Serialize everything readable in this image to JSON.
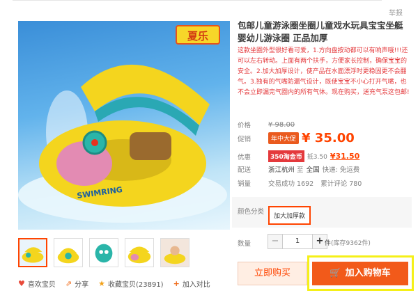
{
  "report_label": "举报",
  "brand_logo": "夏乐",
  "product": {
    "title": "包邮儿童游泳圈坐圈儿童戏水玩具宝宝坐艇婴幼儿游泳圈 正品加厚",
    "description": "这款坐圈外型很好看可爱，1.方向盘按动都可以有响声哦!!!还可以左右转动。上面有两个扶手，方便家长控制，确保宝宝的安全。2.加大加厚设计，使产品在水面漂浮时更稳固更不会翻气。3.独有的气嘴防漏气设计，既使宝宝不小心打开气嘴，也不会立即漏完气圈内的所有气体。现在购买，送充气泵这包邮!"
  },
  "price": {
    "price_label": "价格",
    "original": "¥ 98.00",
    "promo_label": "促销",
    "promo_tag": "年中大促",
    "promo_price": "¥ 35.00",
    "discount_label": "优惠",
    "coupon": "350淘金币",
    "coupon_text": "抵3.50",
    "discount_price": "¥31.50",
    "ship_label": "配送",
    "ship_from": "浙江杭州",
    "ship_to_word": "至",
    "ship_to": "全国",
    "ship_fee": "快递: 免运费",
    "sales_label": "销量",
    "sales": "交易成功 1692",
    "reviews": "累计评论 780"
  },
  "options": {
    "color_label": "颜色分类",
    "color_value": "加大加厚款"
  },
  "quantity": {
    "label": "数量",
    "value": "1",
    "minus": "−",
    "plus": "+",
    "stock_unit": "件",
    "stock": "(库存9362件)"
  },
  "actions": {
    "buy_now": "立即购买",
    "add_to_cart": "加入购物车"
  },
  "social": {
    "like": "喜欢宝贝",
    "share": "分享",
    "favorite": "收藏宝贝(23891)",
    "compare": "加入对比"
  },
  "colors": {
    "accent": "#ff4400",
    "promo_orange": "#ea5a1e",
    "highlight_yellow": "#f5f018"
  }
}
